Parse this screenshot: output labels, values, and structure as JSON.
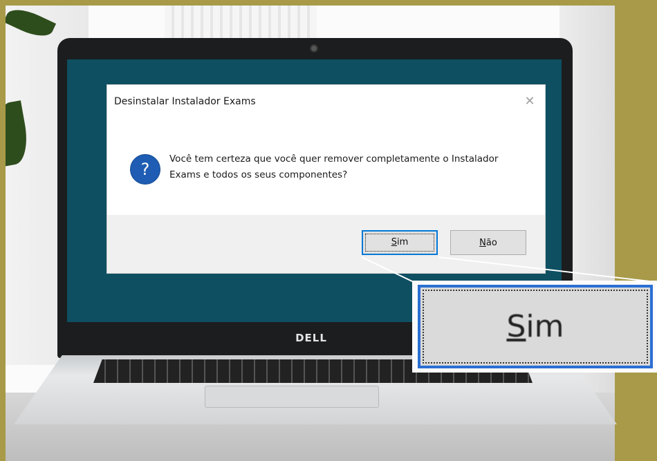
{
  "dialog": {
    "title": "Desinstalar Instalador Exams",
    "close_glyph": "✕",
    "icon_glyph": "?",
    "message_line1": "Você tem certeza que você quer remover completamente o Instalador",
    "message_line2": "Exams e todos os seus componentes?",
    "buttons": {
      "yes_mnemonic": "S",
      "yes_rest": "im",
      "no_mnemonic": "N",
      "no_rest": "ão"
    }
  },
  "laptop": {
    "brand": "DELL"
  },
  "zoom_callout": {
    "mnemonic": "S",
    "rest": "im"
  },
  "colors": {
    "accent": "#0078d7",
    "screen_background": "#0e4f62",
    "page_background": "#a89a48",
    "question_icon": "#1e5db3"
  },
  "icons": [
    "question-icon",
    "close-icon"
  ]
}
